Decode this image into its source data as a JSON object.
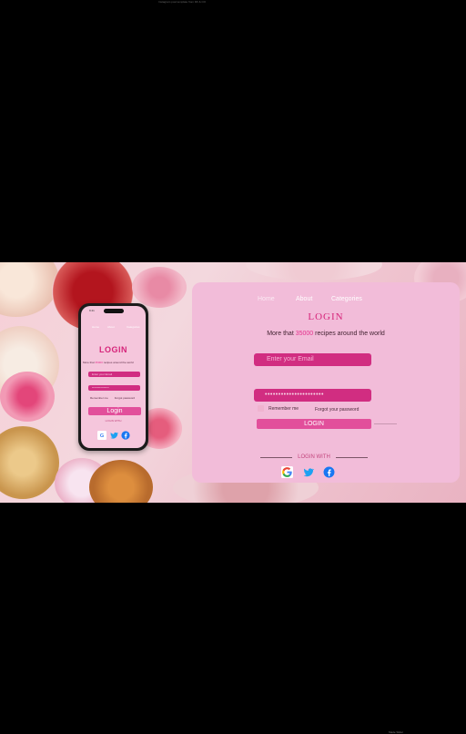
{
  "top_caption": "Instagram post template from DF & CO",
  "bottom_caption": "Made Slider",
  "phone": {
    "status_time": "9:41",
    "nav": [
      "Home",
      "About",
      "Categories"
    ],
    "title": "LOGIN",
    "subtitle_prefix": "More that ",
    "subtitle_number": "35000",
    "subtitle_suffix": " recipes around the world",
    "email_placeholder": "Enter your Email",
    "password_value": "****************",
    "remember": "Remember me",
    "forgot": "Forgot password",
    "login_button": "Login",
    "login_with": "LOGIN WITH"
  },
  "card": {
    "nav": {
      "home": "Home",
      "about": "About",
      "categories": "Categories"
    },
    "logo": "LOGIN",
    "tagline_prefix": "More that ",
    "tagline_number": "35000",
    "tagline_suffix": " recipes around the world",
    "email_placeholder": "Enter your Email",
    "password_value": "••••••••••••••••••••••",
    "remember": "Remember me",
    "forgot": "Forgot your password",
    "login_button": "LOGIN",
    "login_with": "LOGIN WITH",
    "social_icons": [
      "google-icon",
      "twitter-icon",
      "facebook-icon"
    ]
  },
  "colors": {
    "accent": "#d12d81",
    "button": "#e24f9b",
    "card_bg": "#f2bcd9",
    "logo": "#d6247a"
  }
}
